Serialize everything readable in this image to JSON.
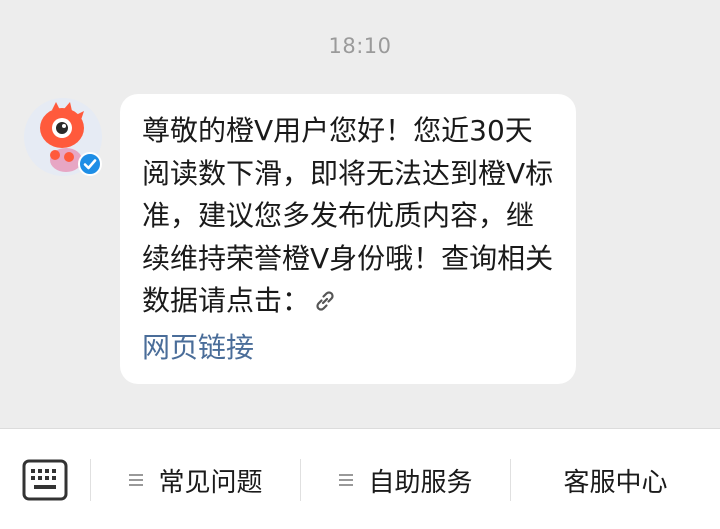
{
  "chat": {
    "timestamp": "18:10",
    "message": {
      "text": "尊敬的橙V用户您好！您近30天阅读数下滑，即将无法达到橙V标准，建议您多发布优质内容，继续维持荣誉橙V身份哦！查询相关数据请点击：",
      "link_label": "网页链接",
      "link_icon": "link-icon"
    },
    "avatar": {
      "icon": "weibo-mascot-avatar",
      "badge_icon": "verified-check-icon",
      "badge_color": "#1e8ee6",
      "primary_color": "#ff5a3c"
    }
  },
  "bottom_bar": {
    "keyboard_icon": "keyboard-icon",
    "items": [
      {
        "label": "常见问题",
        "icon": "menu-lines-icon"
      },
      {
        "label": "自助服务",
        "icon": "menu-lines-icon"
      },
      {
        "label": "客服中心"
      }
    ]
  },
  "colors": {
    "background": "#ededed",
    "bubble": "#ffffff",
    "link": "#4a6d99",
    "timestamp": "#9a9a9a"
  }
}
